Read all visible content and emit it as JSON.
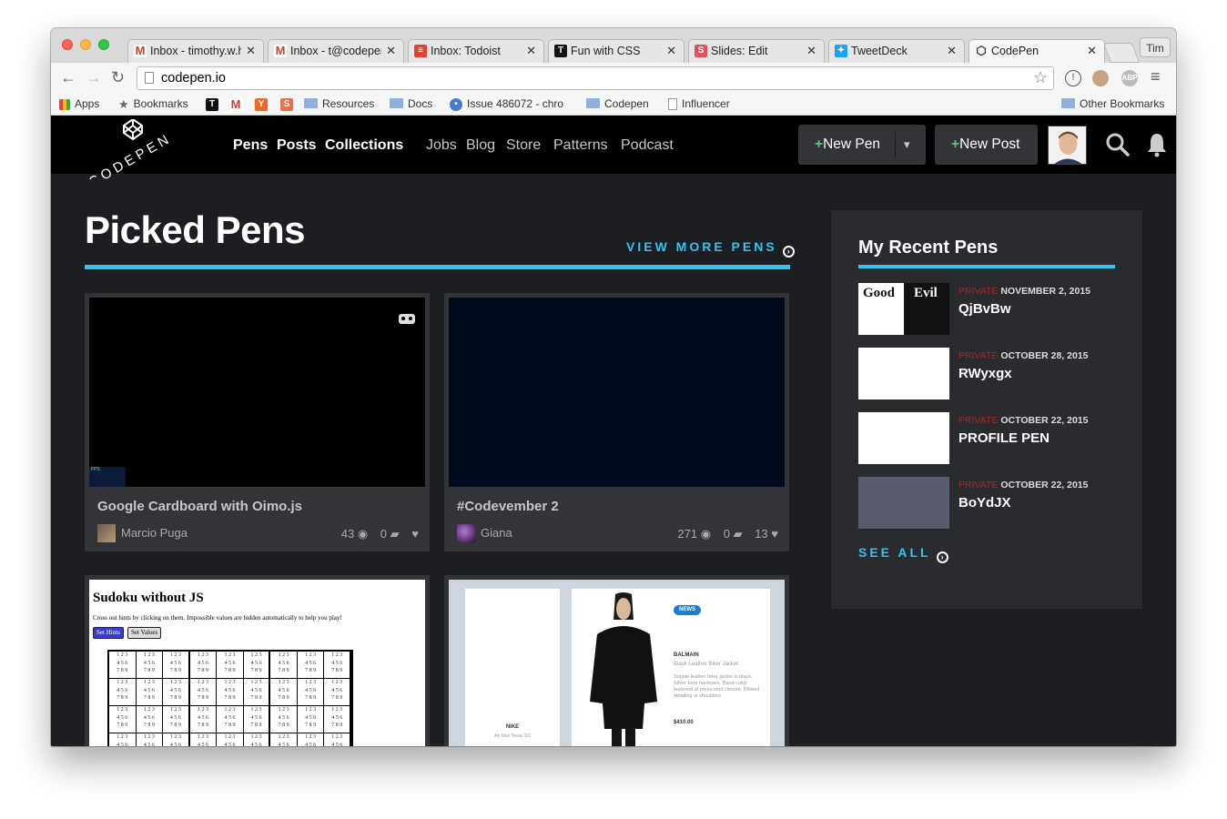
{
  "browser": {
    "tabs": [
      {
        "label": "Inbox - timothy.w.h",
        "favicon": "gmail-icon"
      },
      {
        "label": "Inbox - t@codepen",
        "favicon": "gmail-icon"
      },
      {
        "label": "Inbox: Todoist",
        "favicon": "todoist-icon"
      },
      {
        "label": "Fun with CSS",
        "favicon": "t-icon"
      },
      {
        "label": "Slides: Edit",
        "favicon": "slides-icon"
      },
      {
        "label": "TweetDeck",
        "favicon": "tweetdeck-icon"
      },
      {
        "label": "CodePen",
        "favicon": "codepen-icon"
      }
    ],
    "profile_name": "Tim",
    "url": "codepen.io",
    "extension_abp": "ABP",
    "bookmarks": [
      {
        "label": "Apps",
        "icon": "apps-grid-icon"
      },
      {
        "label": "Bookmarks",
        "icon": "star-icon"
      },
      {
        "label": "",
        "icon": "t-icon"
      },
      {
        "label": "",
        "icon": "gmail-icon"
      },
      {
        "label": "",
        "icon": "ycombinator-icon"
      },
      {
        "label": "",
        "icon": "slides-icon"
      },
      {
        "label": "Resources",
        "icon": "folder-icon"
      },
      {
        "label": "Docs",
        "icon": "folder-icon"
      },
      {
        "label": "Issue 486072 - chro",
        "icon": "chromium-icon"
      },
      {
        "label": "Codepen",
        "icon": "folder-icon"
      },
      {
        "label": "Influencer",
        "icon": "document-icon"
      }
    ],
    "other_bookmarks": "Other Bookmarks"
  },
  "header": {
    "logo_text": "CODEPEN",
    "nav_primary": [
      "Pens",
      "Posts",
      "Collections"
    ],
    "nav_secondary": [
      "Jobs",
      "Blog",
      "Store",
      "Patterns",
      "Podcast"
    ],
    "new_pen": "New Pen",
    "new_post": "New Post",
    "plus": "+"
  },
  "picked": {
    "title": "Picked Pens",
    "view_more": "VIEW MORE PENS",
    "pens": [
      {
        "title": "Google Cardboard with Oimo.js",
        "author": "Marcio Puga",
        "views": "43",
        "comments": "0",
        "hearts": ""
      },
      {
        "title": "#Codevember 2",
        "author": "Giana",
        "views": "271",
        "comments": "0",
        "hearts": "13"
      }
    ],
    "sudoku": {
      "title": "Sudoku without JS",
      "desc": "Cross out hints by clicking on them. Impossible values are hidden automatically to help you play!",
      "btn_hints": "Set Hints",
      "btn_values": "Set Values",
      "row1": "1 2 3",
      "row2": "4 5 6",
      "row3": "7 8 9"
    },
    "shop": {
      "left_brand": "NIKE",
      "left_product": "Air Max Tavas SD",
      "badge": "NEWS",
      "brand": "BALMAIN",
      "product": "Black Leather Biker Jacket",
      "desc": "Supple leather biker jacket in black. Silver-tone hardware. Band collar fastened at press-stud closure. Ribbed detailing at shoulders.",
      "price": "$410.00"
    }
  },
  "recent": {
    "title": "My Recent Pens",
    "private_label": "PRIVATE",
    "items": [
      {
        "date": "NOVEMBER 2, 2015",
        "name": "QjBvBw",
        "thumb_left": "Good",
        "thumb_right": "Evil"
      },
      {
        "date": "OCTOBER 28, 2015",
        "name": "RWyxgx"
      },
      {
        "date": "OCTOBER 22, 2015",
        "name": "PROFILE PEN"
      },
      {
        "date": "OCTOBER 22, 2015",
        "name": "BoYdJX"
      }
    ],
    "see_all": "SEE ALL"
  },
  "colors": {
    "accent": "#2ec6f5",
    "plus_green": "#47cf73",
    "private_red": "#a12a2a",
    "site_bg": "#1d1e22"
  }
}
